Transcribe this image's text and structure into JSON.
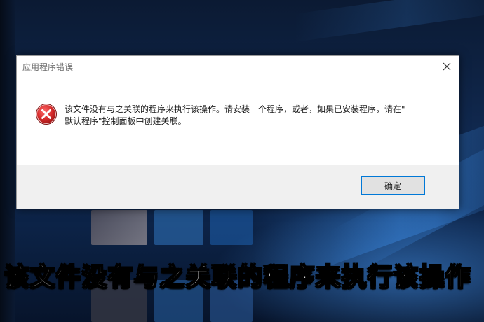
{
  "dialog": {
    "title": "应用程序错误",
    "message_line1": "该文件没有与之关联的程序来执行该操作。请安装一个程序，或者，如果已安装程序，请在\"",
    "message_line2": "默认程序\"控制面板中创建关联。",
    "ok_label": "确定",
    "icon": "error-icon"
  },
  "caption": {
    "text": "该文件没有与之关联的程序来执行该操作"
  },
  "colors": {
    "error_red": "#d42a2a",
    "button_border": "#0078d7",
    "footer_bg": "#f0f0f0"
  }
}
